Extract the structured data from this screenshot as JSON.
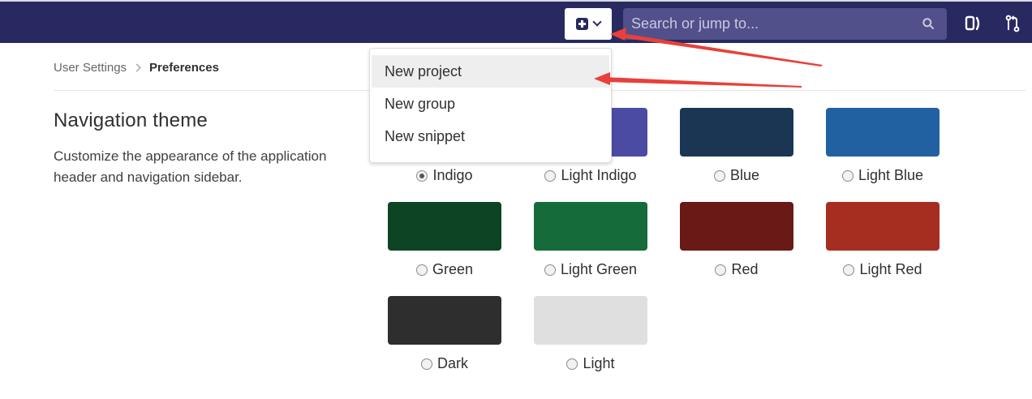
{
  "header": {
    "search_placeholder": "Search or jump to...",
    "brand_color": "#292961",
    "icons": [
      "plus-square-icon",
      "chevron-down-icon",
      "search-icon",
      "issues-icon",
      "merge-request-icon"
    ]
  },
  "breadcrumb": {
    "parent": "User Settings",
    "current": "Preferences"
  },
  "section": {
    "title": "Navigation theme",
    "description": "Customize the appearance of the application header and navigation sidebar."
  },
  "dropdown": {
    "items": [
      {
        "label": "New project"
      },
      {
        "label": "New group"
      },
      {
        "label": "New snippet"
      }
    ]
  },
  "themes": [
    {
      "label": "Indigo",
      "color": "#292961",
      "checked": true
    },
    {
      "label": "Light Indigo",
      "color": "#4b4ba3",
      "checked": false
    },
    {
      "label": "Blue",
      "color": "#1a3652",
      "checked": false
    },
    {
      "label": "Light Blue",
      "color": "#2261a1",
      "checked": false
    },
    {
      "label": "Green",
      "color": "#0d4524",
      "checked": false
    },
    {
      "label": "Light Green",
      "color": "#156b39",
      "checked": false
    },
    {
      "label": "Red",
      "color": "#691a16",
      "checked": false
    },
    {
      "label": "Light Red",
      "color": "#a62e21",
      "checked": false
    },
    {
      "label": "Dark",
      "color": "#2e2e2e",
      "checked": false
    },
    {
      "label": "Light",
      "color": "#dfdfdf",
      "checked": false
    }
  ],
  "annotation": {
    "arrow_color": "#e8403a"
  }
}
